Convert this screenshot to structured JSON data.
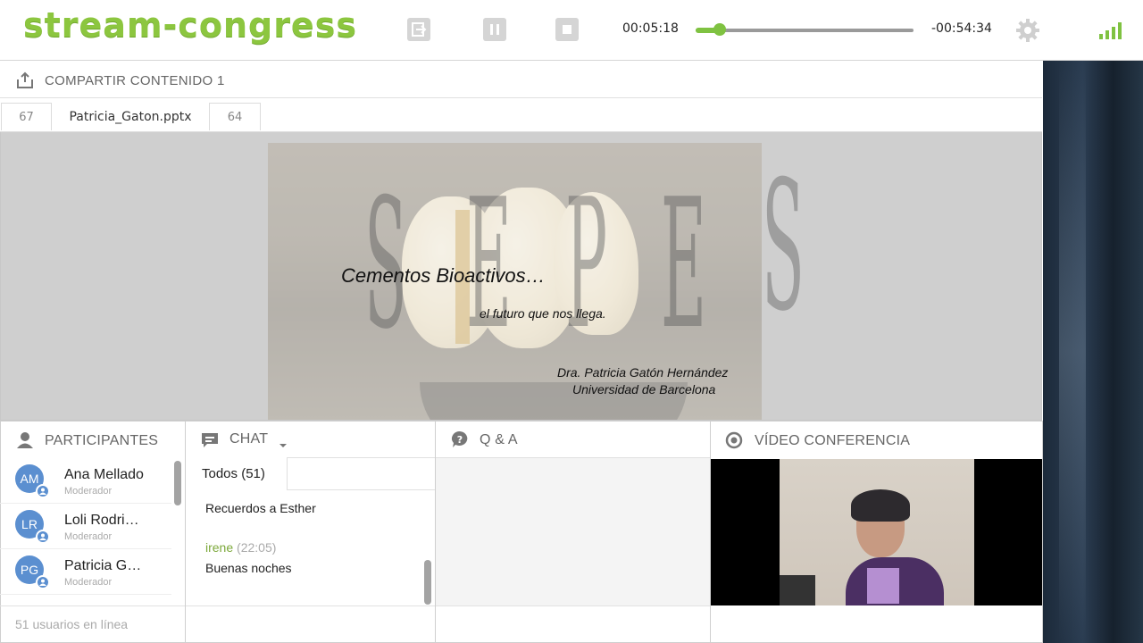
{
  "app": {
    "logo": "stream-congress",
    "time_elapsed": "00:05:18",
    "time_remaining": "-00:54:34",
    "progress": 0.11,
    "accent_color": "#8cc63f",
    "controls": [
      {
        "name": "exit-icon"
      },
      {
        "name": "pause-icon"
      },
      {
        "name": "stop-icon"
      },
      {
        "name": "gear-icon"
      },
      {
        "name": "signal-bars-icon"
      }
    ]
  },
  "presentation": {
    "title": "COMPARTIR CONTENIDO 1",
    "tabs": [
      "67",
      "Patricia_Gaton.pptx",
      "64"
    ],
    "active_tab": "Patricia_Gaton.pptx",
    "slide": {
      "watermark": "SEPES",
      "title": "Cementos Bioactivos…",
      "subtitle": "el futuro que nos llega.",
      "author": "Dra. Patricia Gatón Hernández",
      "affiliation": "Universidad de Barcelona"
    }
  },
  "participants": {
    "title": "PARTICIPANTES",
    "items": [
      {
        "initials": "AM",
        "name": "Ana Mellado",
        "role": "Moderador"
      },
      {
        "initials": "LR",
        "name": "Loli Rodri…",
        "role": "Moderador"
      },
      {
        "initials": "PG",
        "name": "Patricia G…",
        "role": "Moderador"
      }
    ],
    "online_text": "51 usuarios en línea"
  },
  "chat": {
    "title": "CHAT",
    "tab_label": "Todos (51)",
    "messages": [
      {
        "user": "",
        "time": "",
        "text": "Recuerdos a Esther"
      },
      {
        "user": "irene",
        "time": "(22:05)",
        "text": "Buenas noches"
      }
    ]
  },
  "qa": {
    "title": "Q & A"
  },
  "video": {
    "title": "VÍDEO CONFERENCIA"
  }
}
